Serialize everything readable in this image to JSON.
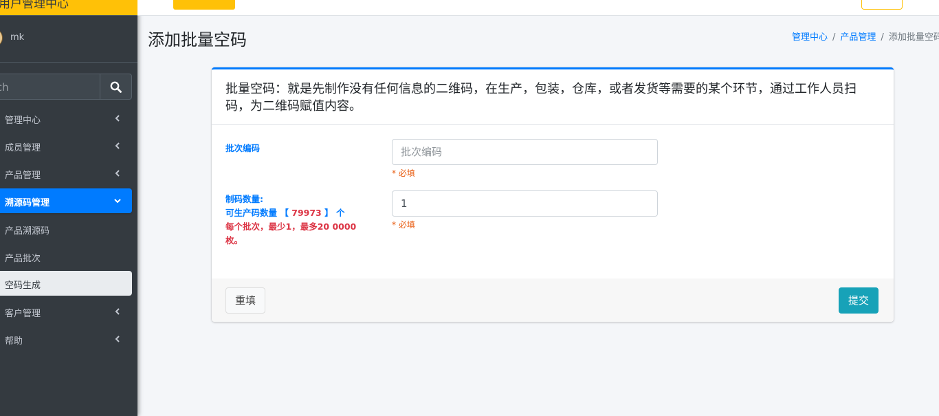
{
  "brand": {
    "title": "用户管理中心"
  },
  "user": {
    "name": "mk"
  },
  "search": {
    "placeholder": "Search",
    "visible_fragment": "rch"
  },
  "sidebar": {
    "items": [
      {
        "label": "管理中心"
      },
      {
        "label": "成员管理"
      },
      {
        "label": "产品管理"
      },
      {
        "label": "溯源码管理"
      },
      {
        "label": "产品溯源码"
      },
      {
        "label": "产品批次"
      },
      {
        "label": "空码生成"
      },
      {
        "label": "客户管理"
      },
      {
        "label": "帮助"
      }
    ]
  },
  "header": {
    "title": "添加批量空码",
    "breadcrumb": [
      "管理中心",
      "产品管理",
      "添加批量空码"
    ]
  },
  "card": {
    "description": "批量空码：就是先制作没有任何信息的二维码，在生产，包装，仓库，或者发货等需要的某个环节，通过工作人员扫码，为二维码赋值内容。",
    "batch_label": "批次编码",
    "batch_placeholder": "批次编码",
    "required_text": "* 必填",
    "qty_label": "制码数量:",
    "avail_prefix": "可生产码数量",
    "avail_open": "【",
    "avail_count": "79973",
    "avail_close": "】",
    "avail_suffix": "个",
    "rule_line1": "每个批次，最少1，最多20 0000",
    "rule_line2": "枚。",
    "qty_value": "1"
  },
  "footer": {
    "reset_label": "重填",
    "submit_label": "提交"
  },
  "colors": {
    "primary": "#007bff",
    "brand": "#ffc107",
    "sidebar": "#343a40",
    "submit": "#17a2b8",
    "required": "#e8590c",
    "warning_text": "#dc3545"
  }
}
